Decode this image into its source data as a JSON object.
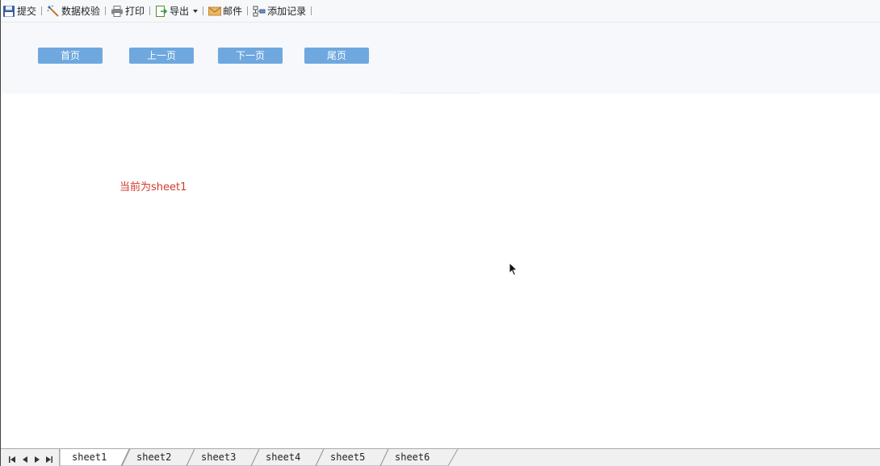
{
  "toolbar": {
    "items": [
      {
        "label": "提交",
        "icon": "save-icon"
      },
      {
        "label": "数据校验",
        "icon": "wand-icon"
      },
      {
        "label": "打印",
        "icon": "printer-icon"
      },
      {
        "label": "导出",
        "icon": "export-icon"
      },
      {
        "label": "邮件",
        "icon": "mail-icon"
      },
      {
        "label": "添加记录",
        "icon": "add-record-icon"
      }
    ]
  },
  "pagination": {
    "first": "首页",
    "prev": "上一页",
    "next": "下一页",
    "last": "尾页"
  },
  "content": {
    "current_sheet_text": "当前为sheet1"
  },
  "sheet_tabs": [
    "sheet1",
    "sheet2",
    "sheet3",
    "sheet4",
    "sheet5",
    "sheet6"
  ],
  "colors": {
    "nav_button": "#6ea8de",
    "highlight_text": "#d23b2c"
  }
}
